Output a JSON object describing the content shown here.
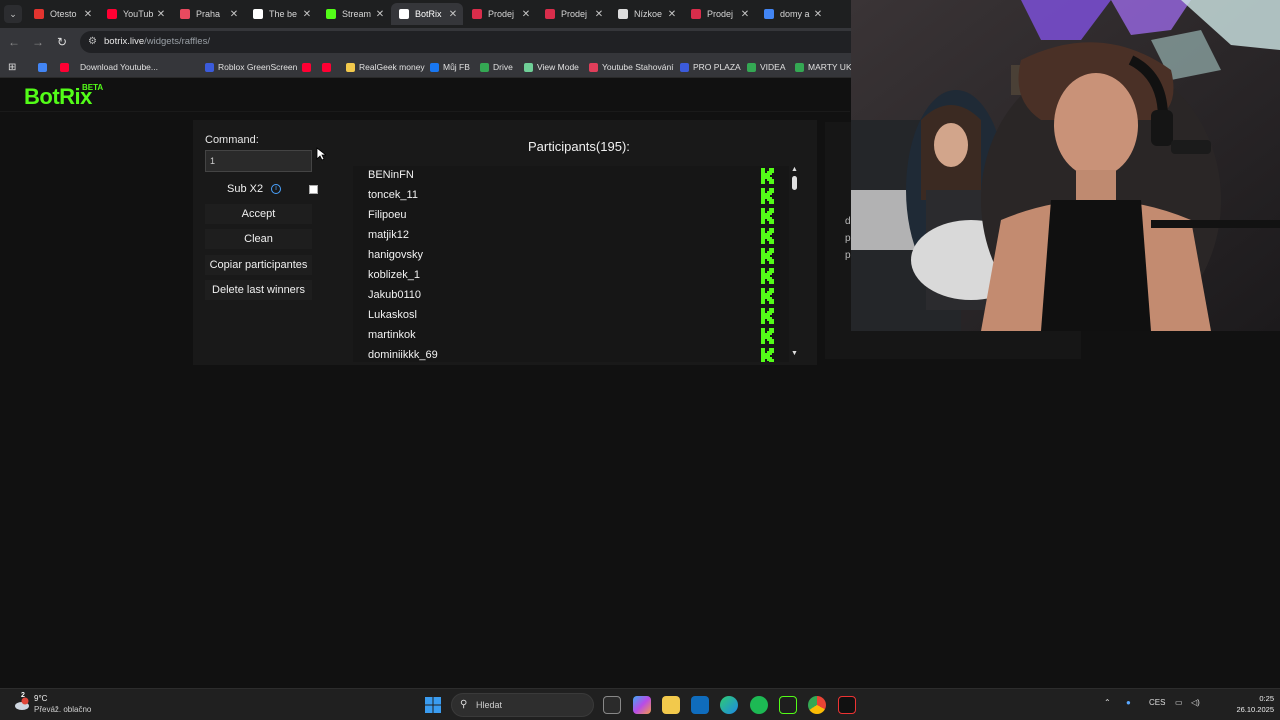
{
  "browser": {
    "tabs": [
      {
        "title": "Otesto",
        "color": "#e3342f"
      },
      {
        "title": "YouTub",
        "color": "#ff0033"
      },
      {
        "title": "Praha",
        "color": "#e84a5f"
      },
      {
        "title": "The be",
        "color": "#ffffff"
      },
      {
        "title": "Stream",
        "color": "#53fc18"
      },
      {
        "title": "BotRix",
        "color": "#ffffff"
      },
      {
        "title": "Prodej",
        "color": "#d92d4b"
      },
      {
        "title": "Prodej",
        "color": "#d92d4b"
      },
      {
        "title": "Nízkoe",
        "color": "#dddddd"
      },
      {
        "title": "Prodej",
        "color": "#d92d4b"
      },
      {
        "title": "domy a",
        "color": "#4285f4"
      }
    ],
    "url_host": "botrix.live",
    "url_path": "/widgets/raffles/",
    "bookmarks": [
      {
        "label": "",
        "color": "#4285f4"
      },
      {
        "label": "",
        "color": "#ff0033"
      },
      {
        "label": "Download Youtube...",
        "color": ""
      },
      {
        "label": "Roblox GreenScreen",
        "color": "#3b5bdb"
      },
      {
        "label": "",
        "color": "#ff0033"
      },
      {
        "label": "",
        "color": "#ff0033"
      },
      {
        "label": "RealGeek money",
        "color": "#f2c94c"
      },
      {
        "label": "Můj FB",
        "color": "#1877f2"
      },
      {
        "label": "Drive",
        "color": "#34a853"
      },
      {
        "label": "View Mode",
        "color": "#6fcf97"
      },
      {
        "label": "Youtube Stahování",
        "color": "#e03e5a"
      },
      {
        "label": "PRO PLAZA",
        "color": "#3b5bdb"
      },
      {
        "label": "VIDEA",
        "color": "#34a853"
      },
      {
        "label": "MARTY UKOLY",
        "color": "#34a853"
      }
    ]
  },
  "app": {
    "logo": "BotRix",
    "badge": "BETA",
    "accent": "#53fc18"
  },
  "controls": {
    "command_label": "Command:",
    "command_value": "1",
    "sub_label": "Sub X2",
    "sub_info_icon": "ⓘ",
    "accept_label": "Accept",
    "clean_label": "Clean",
    "copy_label": "Copiar participantes",
    "delete_label": "Delete last winners"
  },
  "participants": {
    "title": "Participants(195):",
    "platform_icon": "kick-icon",
    "names": [
      "BENinFN",
      "toncek_11",
      "Filipoeu",
      "matjik12",
      "hanigovsky",
      "koblizek_1",
      "Jakub0110",
      "Lukaskosl",
      "martinkok",
      "dominiikkk_69"
    ]
  },
  "side_panel": {
    "fragments": [
      "d",
      "p",
      "p"
    ]
  },
  "taskbar": {
    "weather_temp": "9°C",
    "weather_desc": "Převáž. oblačno",
    "weather_badge": "2",
    "search_placeholder": "Hledat",
    "language": "CES",
    "time": "0:25",
    "date": "26.10.2025"
  }
}
